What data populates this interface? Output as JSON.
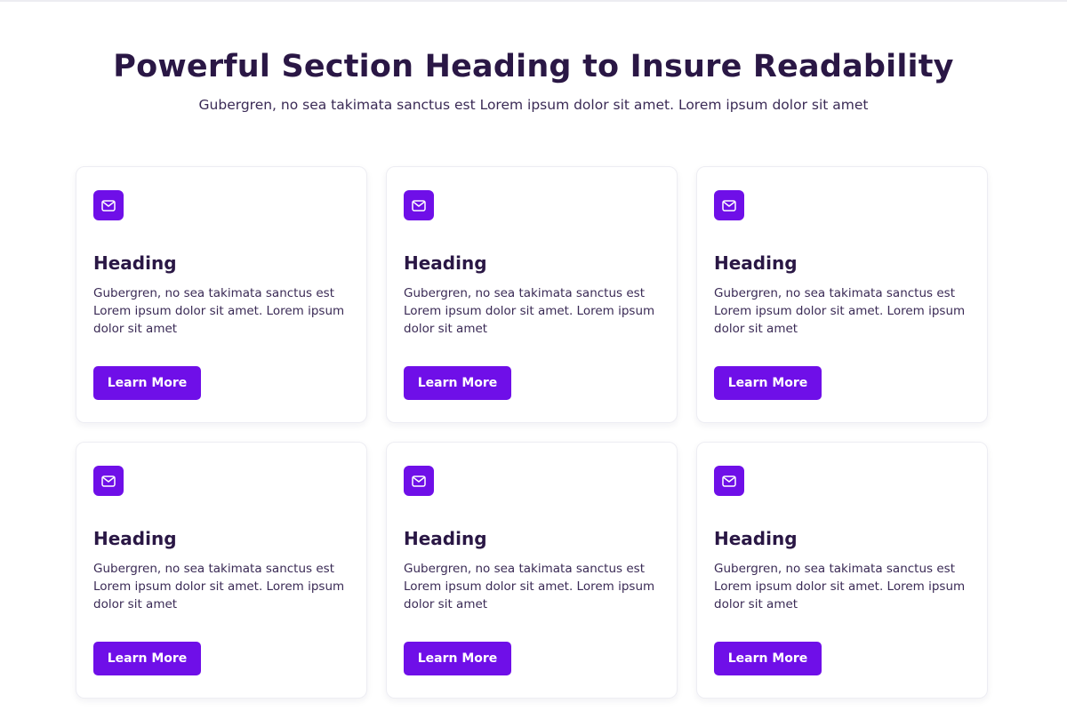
{
  "section": {
    "heading": "Powerful Section Heading to Insure Readability",
    "subtitle": "Gubergren, no sea takimata sanctus est Lorem ipsum dolor sit amet. Lorem ipsum dolor sit amet"
  },
  "theme": {
    "accent": "#6f0fe8",
    "text_dark": "#2a1745",
    "card_border": "#ededf3"
  },
  "cards": [
    {
      "icon": "mail-icon",
      "heading": "Heading",
      "body": "Gubergren, no sea takimata sanctus est Lorem ipsum dolor sit amet. Lorem ipsum dolor sit amet",
      "button_label": "Learn More"
    },
    {
      "icon": "mail-icon",
      "heading": "Heading",
      "body": "Gubergren, no sea takimata sanctus est Lorem ipsum dolor sit amet. Lorem ipsum dolor sit amet",
      "button_label": "Learn More"
    },
    {
      "icon": "mail-icon",
      "heading": "Heading",
      "body": "Gubergren, no sea takimata sanctus est Lorem ipsum dolor sit amet. Lorem ipsum dolor sit amet",
      "button_label": "Learn More"
    },
    {
      "icon": "mail-icon",
      "heading": "Heading",
      "body": "Gubergren, no sea takimata sanctus est Lorem ipsum dolor sit amet. Lorem ipsum dolor sit amet",
      "button_label": "Learn More"
    },
    {
      "icon": "mail-icon",
      "heading": "Heading",
      "body": "Gubergren, no sea takimata sanctus est Lorem ipsum dolor sit amet. Lorem ipsum dolor sit amet",
      "button_label": "Learn More"
    },
    {
      "icon": "mail-icon",
      "heading": "Heading",
      "body": "Gubergren, no sea takimata sanctus est Lorem ipsum dolor sit amet. Lorem ipsum dolor sit amet",
      "button_label": "Learn More"
    }
  ]
}
